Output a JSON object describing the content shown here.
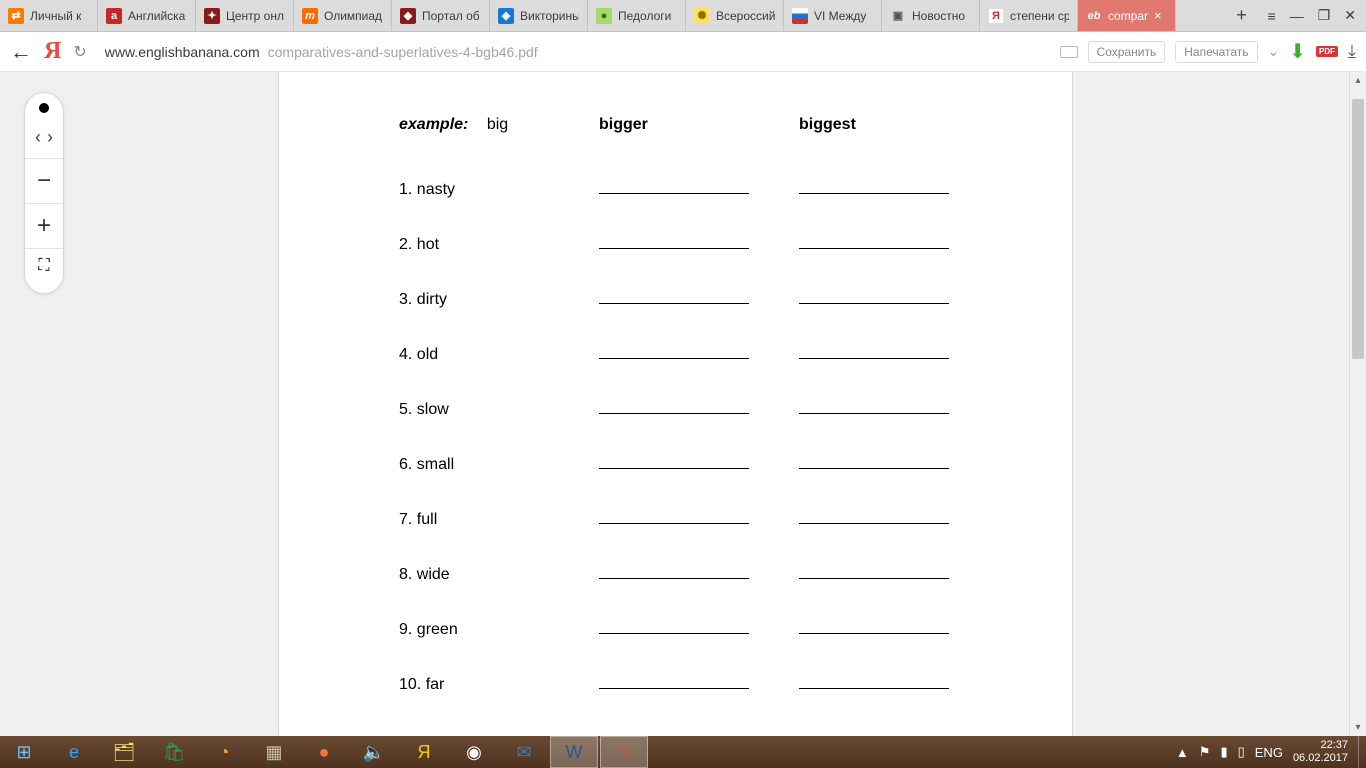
{
  "tabs": [
    {
      "label": "Личный к",
      "favclass": "fi-orange",
      "favtext": "⇄"
    },
    {
      "label": "Английска",
      "favclass": "fi-red",
      "favtext": "a"
    },
    {
      "label": "Центр онл",
      "favclass": "fi-darkred",
      "favtext": "✦"
    },
    {
      "label": "Олимпиад",
      "favclass": "fi-morange",
      "favtext": "m"
    },
    {
      "label": "Портал об",
      "favclass": "fi-darkred",
      "favtext": "◆"
    },
    {
      "label": "Викторины",
      "favclass": "fi-blue",
      "favtext": "◈"
    },
    {
      "label": "Педологи",
      "favclass": "fi-green",
      "favtext": "●"
    },
    {
      "label": "Всероссий",
      "favclass": "fi-yellow",
      "favtext": "✺"
    },
    {
      "label": "VI Между",
      "favclass": "fi-flag",
      "favtext": ""
    },
    {
      "label": "Новостно",
      "favclass": "fi-gray",
      "favtext": "▣"
    },
    {
      "label": "степени ср",
      "favclass": "fi-white",
      "favtext": "Я"
    },
    {
      "label": "compar",
      "favclass": "fi-pink",
      "favtext": "eb",
      "active": true
    }
  ],
  "window_controls": {
    "menu": "≡",
    "min": "—",
    "max": "❐",
    "close": "✕"
  },
  "addr": {
    "back": "←",
    "logo": "Я",
    "reload": "↻",
    "domain": "www.englishbanana.com",
    "path": "comparatives-and-superlatives-4-bgb46.pdf",
    "protect": "Сохранить",
    "print": "Напечатать",
    "pdf_badge": "PDF"
  },
  "pdf_nav": {
    "prev": "‹",
    "next": "›",
    "minus": "−",
    "plus": "+",
    "fit": "⛶"
  },
  "doc": {
    "example_label": "example:",
    "example_word": "big",
    "example_comp": "bigger",
    "example_sup": "biggest",
    "items": [
      {
        "n": "1.",
        "w": "nasty"
      },
      {
        "n": "2.",
        "w": "hot"
      },
      {
        "n": "3.",
        "w": "dirty"
      },
      {
        "n": "4.",
        "w": "old"
      },
      {
        "n": "5.",
        "w": "slow"
      },
      {
        "n": "6.",
        "w": "small"
      },
      {
        "n": "7.",
        "w": "full"
      },
      {
        "n": "8.",
        "w": "wide"
      },
      {
        "n": "9.",
        "w": "green"
      },
      {
        "n": "10.",
        "w": "far"
      }
    ]
  },
  "taskbar_icons": [
    {
      "name": "start",
      "glyph": "⊞",
      "color": "#6ec1ff"
    },
    {
      "name": "ie",
      "glyph": "e",
      "color": "#39a0ed"
    },
    {
      "name": "explorer",
      "glyph": "🗂",
      "color": "#ffd76a"
    },
    {
      "name": "store",
      "glyph": "🛍",
      "color": "#2e9e4f"
    },
    {
      "name": "media",
      "glyph": "◔",
      "color": "#ff9f2e"
    },
    {
      "name": "app-gray",
      "glyph": "▦",
      "color": "#c8bfa7"
    },
    {
      "name": "firefox",
      "glyph": "●",
      "color": "#ff7139"
    },
    {
      "name": "sound",
      "glyph": "🔈",
      "color": "#6aa6ff"
    },
    {
      "name": "yandex-search",
      "glyph": "Я",
      "color": "#ffcc00"
    },
    {
      "name": "chrome",
      "glyph": "◉",
      "color": "#ffffff"
    },
    {
      "name": "mail",
      "glyph": "✉",
      "color": "#3b78c4"
    },
    {
      "name": "word",
      "glyph": "W",
      "color": "#2b579a",
      "active": true
    },
    {
      "name": "yabrowser",
      "glyph": "Y",
      "color": "#d94f3a",
      "active": true
    }
  ],
  "tray": {
    "up": "▲",
    "flag": "⚑",
    "battery": "▮",
    "net": "▮",
    "signal": "▯",
    "lang": "ENG",
    "time": "22:37",
    "date": "06.02.2017"
  }
}
